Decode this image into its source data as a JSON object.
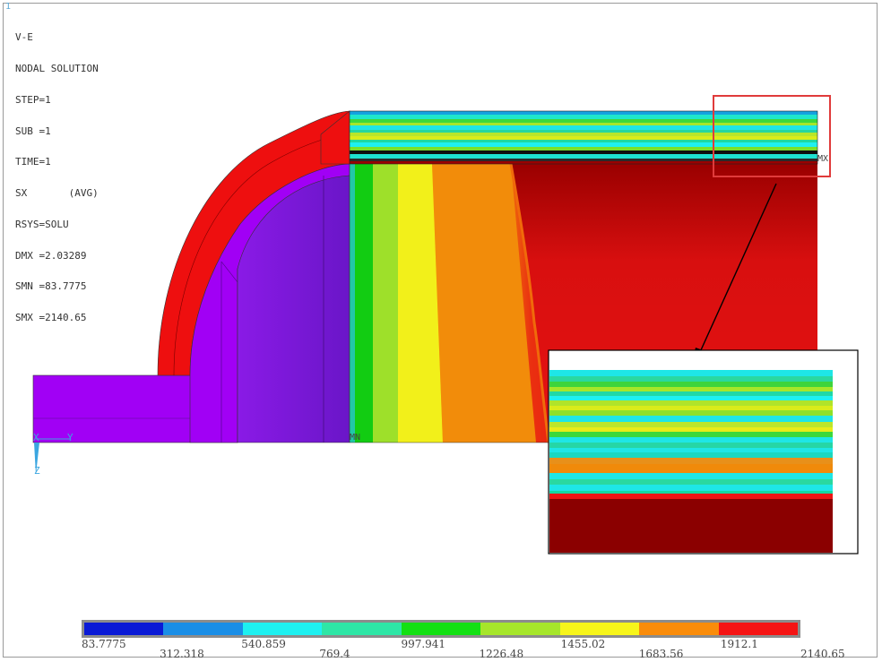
{
  "window_index": "1",
  "info": {
    "title": "V-E",
    "solution": "NODAL SOLUTION",
    "step": "STEP=1",
    "sub": "SUB =1",
    "time": "TIME=1",
    "component": "SX",
    "avg": "(AVG)",
    "rsys": "RSYS=SOLU",
    "dmx": "DMX =2.03289",
    "smn": "SMN =83.7775",
    "smx": "SMX =2140.65"
  },
  "markers": {
    "min": "MN",
    "max": "MX",
    "triad_x": "X",
    "triad_y": "Y",
    "triad_z": "Z"
  },
  "legend": {
    "colors": [
      "#0a1ad6",
      "#1a8ee6",
      "#1ef0f0",
      "#2ee6a6",
      "#13e013",
      "#a6e62a",
      "#f7f51a",
      "#fa8c0a",
      "#f51414"
    ],
    "ticks_top": [
      "83.7775",
      "540.859",
      "997.941",
      "1455.02",
      "1912.1"
    ],
    "ticks_bottom": [
      "312.318",
      "769.4",
      "1226.48",
      "1683.56",
      "2140.65"
    ]
  },
  "colors": {
    "purple": "#a100f5",
    "violet": "#7a1ad9",
    "red": "#ee0f0f",
    "darkred": "#8b0000",
    "callout": "#e03b3b"
  }
}
